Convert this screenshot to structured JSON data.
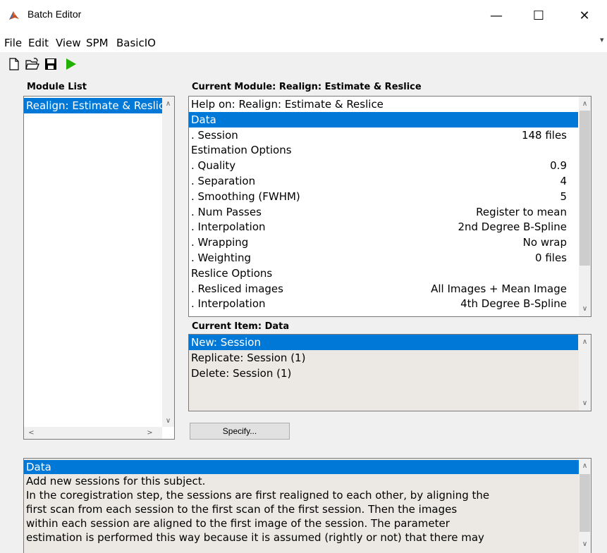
{
  "window": {
    "title": "Batch Editor",
    "minimize_glyph": "—",
    "maximize_glyph": "☐",
    "close_glyph": "✕"
  },
  "menu": {
    "items": [
      "File",
      "Edit",
      "View",
      "SPM",
      "BasicIO"
    ],
    "pin_glyph": "▾"
  },
  "toolbar": {
    "icons": [
      "new-file-icon",
      "open-folder-icon",
      "save-icon",
      "run-icon"
    ],
    "run_color": "#22b000"
  },
  "module_list": {
    "header": "Module List",
    "items": [
      "Realign: Estimate & Reslice"
    ]
  },
  "current_module": {
    "header": "Current Module: Realign: Estimate & Reslice",
    "rows": [
      {
        "label": "Help on: Realign: Estimate & Reslice",
        "value": ""
      },
      {
        "label": "Data",
        "value": ""
      },
      {
        "label": ". Session",
        "value": "148 files"
      },
      {
        "label": "Estimation Options",
        "value": ""
      },
      {
        "label": ". Quality",
        "value": "0.9"
      },
      {
        "label": ". Separation",
        "value": "4"
      },
      {
        "label": ". Smoothing (FWHM)",
        "value": "5"
      },
      {
        "label": ". Num Passes",
        "value": "Register to mean"
      },
      {
        "label": ". Interpolation",
        "value": "2nd Degree B-Spline"
      },
      {
        "label": ". Wrapping",
        "value": "No wrap"
      },
      {
        "label": ". Weighting",
        "value": "0 files"
      },
      {
        "label": "Reslice Options",
        "value": ""
      },
      {
        "label": ". Resliced images",
        "value": "All Images + Mean Image"
      },
      {
        "label": ". Interpolation",
        "value": "4th Degree B-Spline"
      }
    ]
  },
  "current_item": {
    "header": "Current Item: Data",
    "items": [
      "New: Session",
      "Replicate: Session (1)",
      "Delete: Session (1)"
    ]
  },
  "specify_button": "Specify...",
  "help": {
    "lines": [
      "Data",
      "Add new sessions for this subject.",
      "In  the coregistration step, the sessions are first realigned to each other, by aligning the",
      "first  scan  from  each  session  to  the  first scan of the first session.  Then the images",
      "within  each  session  are  aligned  to  the  first  image  of  the  session. The parameter",
      "estimation  is  performed  this way because it is assumed (rightly or not) that there may"
    ]
  },
  "colors": {
    "selection": "#0078d7",
    "panel": "#f0f0f0",
    "scroll_thumb": "#cdcdcd"
  }
}
